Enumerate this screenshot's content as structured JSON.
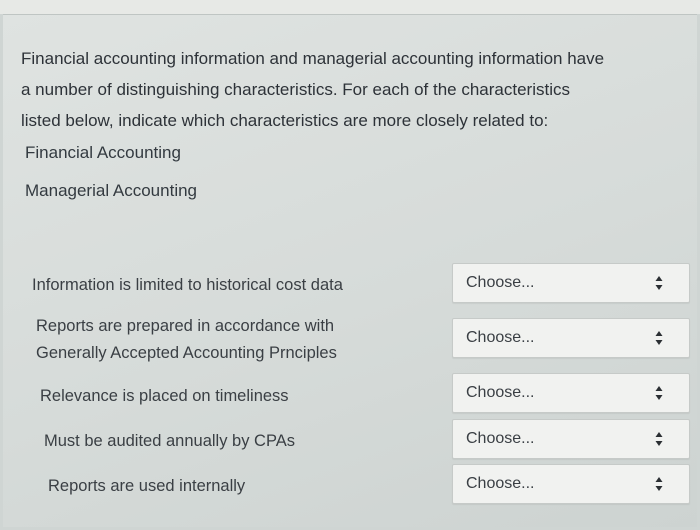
{
  "intro": {
    "line1": "Financial accounting information and managerial accounting information have",
    "line2": "a number of distinguishing characteristics. For each of the characteristics",
    "line3": "listed below, indicate which characteristics are more closely related to:"
  },
  "choices": [
    "Financial Accounting",
    "Managerial Accounting"
  ],
  "rows": [
    {
      "line1": "Information is limited to historical cost data",
      "line2": "",
      "select": "Choose..."
    },
    {
      "line1": "Reports are prepared in accordance with",
      "line2": "Generally Accepted Accounting Prnciples",
      "select": "Choose..."
    },
    {
      "line1": "Relevance is placed on timeliness",
      "line2": "",
      "select": "Choose..."
    },
    {
      "line1": "Must be audited annually by CPAs",
      "line2": "",
      "select": "Choose..."
    },
    {
      "line1": "Reports are used internally",
      "line2": "",
      "select": "Choose..."
    }
  ],
  "icons": {
    "select_arrows": "up-down-arrows-icon"
  }
}
